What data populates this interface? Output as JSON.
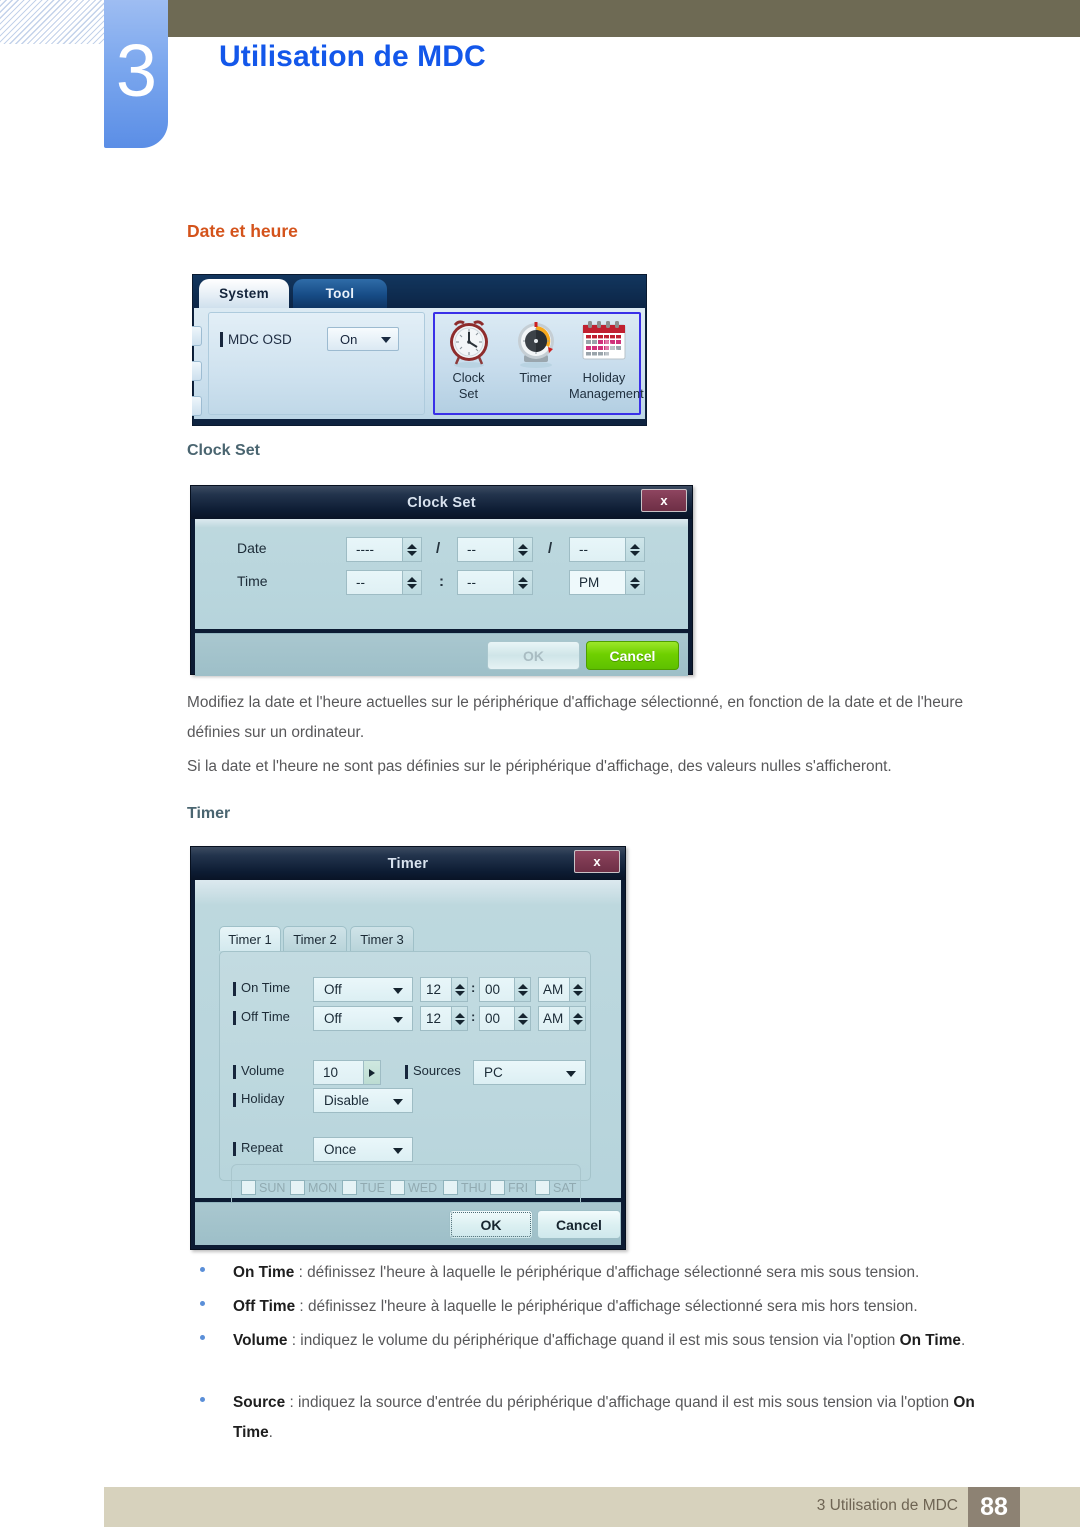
{
  "header": {
    "chapter_number": "3",
    "title": "Utilisation de MDC"
  },
  "section": {
    "heading": "Date et heure",
    "sub_clock_set": "Clock Set",
    "sub_timer": "Timer"
  },
  "screenshot_system": {
    "tab_system": "System",
    "tab_tool": "Tool",
    "osd_label": "MDC OSD",
    "osd_value": "On",
    "icons": [
      {
        "name": "clock-set-icon",
        "caption_line1": "Clock",
        "caption_line2": "Set"
      },
      {
        "name": "timer-icon",
        "caption_line1": "Timer",
        "caption_line2": ""
      },
      {
        "name": "holiday-management-icon",
        "caption_line1": "Holiday",
        "caption_line2": "Management"
      }
    ]
  },
  "clock_set_dialog": {
    "title": "Clock Set",
    "close_label": "x",
    "date_label": "Date",
    "time_label": "Time",
    "date_year": "----",
    "date_month": "--",
    "date_day": "--",
    "time_hour": "--",
    "time_minute": "--",
    "time_meridiem": "PM",
    "date_sep1": "/",
    "date_sep2": "/",
    "time_sep": ":",
    "ok_label": "OK",
    "cancel_label": "Cancel"
  },
  "timer_dialog": {
    "title": "Timer",
    "close_label": "x",
    "tabs": [
      "Timer 1",
      "Timer 2",
      "Timer 3"
    ],
    "on_time_label": "On Time",
    "on_time_value": "Off",
    "on_time_hour": "12",
    "on_time_minute": "00",
    "on_time_meridiem": "AM",
    "off_time_label": "Off Time",
    "off_time_value": "Off",
    "off_time_hour": "12",
    "off_time_minute": "00",
    "off_time_meridiem": "AM",
    "volume_label": "Volume",
    "volume_value": "10",
    "sources_label": "Sources",
    "sources_value": "PC",
    "holiday_label": "Holiday",
    "holiday_value": "Disable",
    "repeat_label": "Repeat",
    "repeat_value": "Once",
    "time_sep": ":",
    "days": [
      "SUN",
      "MON",
      "TUE",
      "WED",
      "THU",
      "FRI",
      "SAT"
    ],
    "ok_label": "OK",
    "cancel_label": "Cancel"
  },
  "paragraphs": {
    "p1": "Modifiez la date et l'heure actuelles sur le périphérique d'affichage sélectionné, en fonction de la date et de l'heure définies sur un ordinateur.",
    "p2": "Si la date et l'heure ne sont pas définies sur le périphérique d'affichage, des valeurs nulles s'afficheront."
  },
  "bullets": [
    {
      "term": "On Time",
      "rest": " : définissez l'heure à laquelle le périphérique d'affichage sélectionné sera mis sous tension."
    },
    {
      "term": "Off Time",
      "rest": " : définissez l'heure à laquelle le périphérique d'affichage sélectionné sera mis hors tension."
    },
    {
      "term": "Volume",
      "rest": " : indiquez le volume du périphérique d'affichage quand il est mis sous tension via l'option ",
      "term2": "On Time",
      "rest2": "."
    },
    {
      "term": "Source",
      "rest": " : indiquez la source d'entrée du périphérique d'affichage quand il est mis sous tension via l'option ",
      "term2": "On Time",
      "rest2": "."
    }
  ],
  "footer": {
    "text": "3 Utilisation de MDC",
    "page_number": "88"
  },
  "colors": {
    "accent_orange": "#d4531b",
    "title_blue": "#1357ea",
    "olive": "#6e6a54",
    "footer_bg": "#d7d2bd",
    "page_box": "#8d8273",
    "highlight_border": "#3a30e8",
    "cancel_green": "#6fd000"
  }
}
